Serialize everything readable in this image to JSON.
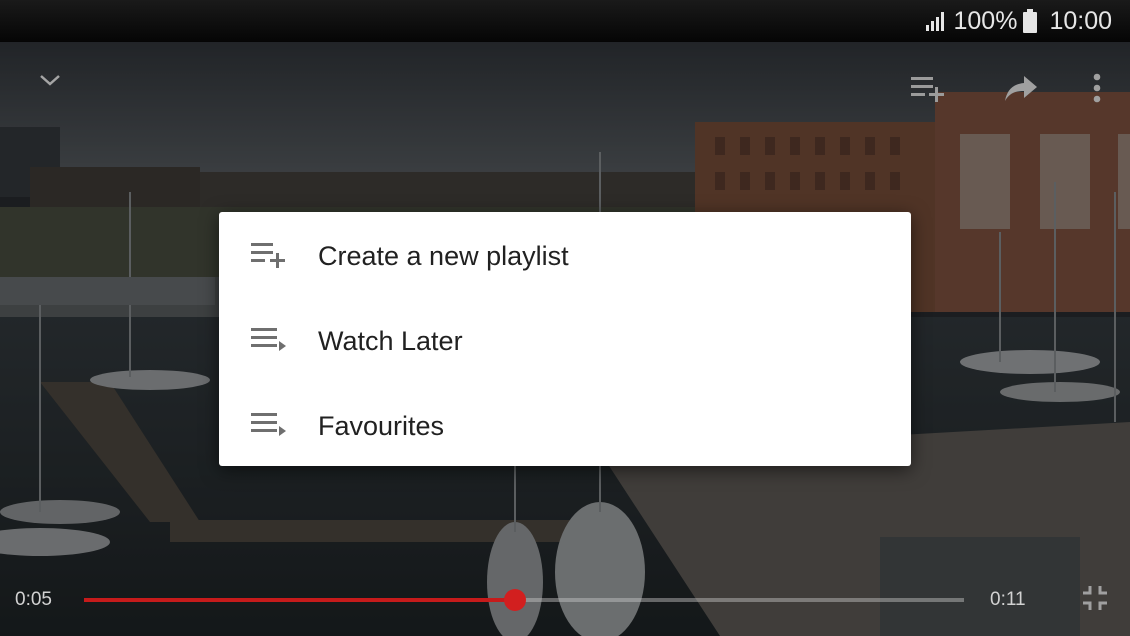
{
  "status_bar": {
    "battery_percent": "100%",
    "time": "10:00",
    "icons": [
      "signal-icon",
      "battery-icon"
    ]
  },
  "player": {
    "current_time": "0:05",
    "total_time": "0:11",
    "progress_fraction": 0.49,
    "accent_color": "#c61b1b",
    "top_controls": [
      "chevron-down-icon",
      "add-to-playlist-icon",
      "share-icon",
      "more-vert-icon"
    ],
    "bottom_controls": [
      "exit-fullscreen-icon"
    ]
  },
  "dialog": {
    "items": [
      {
        "label": "Create a new playlist",
        "icon": "playlist-add-icon"
      },
      {
        "label": "Watch Later",
        "icon": "playlist-play-icon"
      },
      {
        "label": "Favourites",
        "icon": "playlist-play-icon"
      }
    ]
  }
}
